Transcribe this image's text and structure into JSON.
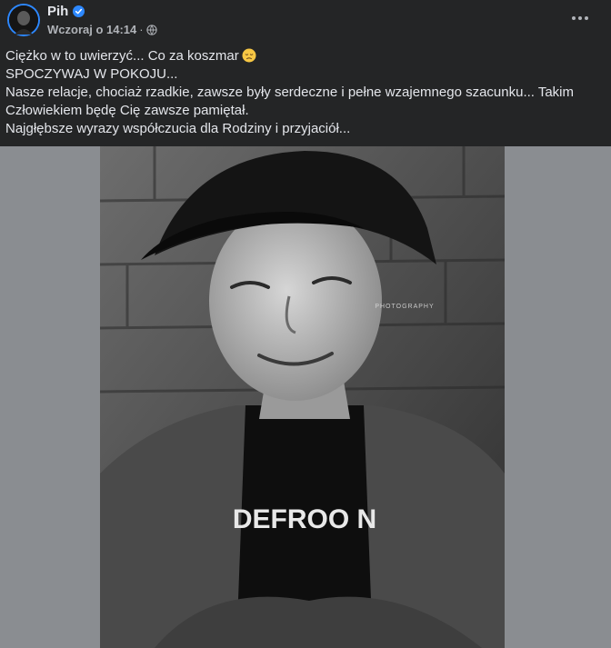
{
  "post": {
    "author": "Pih",
    "author_verified": true,
    "timestamp": "Wczoraj o 14:14",
    "separator": "·",
    "audience_icon": "globe-icon",
    "more_icon": "more-dots-icon",
    "lines": [
      "Ciężko w to uwierzyć... Co za koszmar",
      "SPOCZYWAJ W POKOJU...",
      "Nasze relacje, chociaż rzadkie, zawsze były serdeczne i pełne wzajemnego szacunku... Takim Człowiekiem będę Cię zawsze pamiętał.",
      "Najgłębsze wyrazy współczucia dla Rodziny i przyjaciół..."
    ],
    "emoji": "sad-face-emoji",
    "photo": {
      "description_icon": "black-and-white-portrait-photo",
      "watermark_text": "PHOTOGRAPHY",
      "shirt_text": "DEFROO N"
    }
  },
  "colors": {
    "background": "#242526",
    "text": "#e4e6eb",
    "secondary_text": "#b0b3b8",
    "verified_badge": "#2d88ff",
    "media_background": "#8a8d91"
  }
}
